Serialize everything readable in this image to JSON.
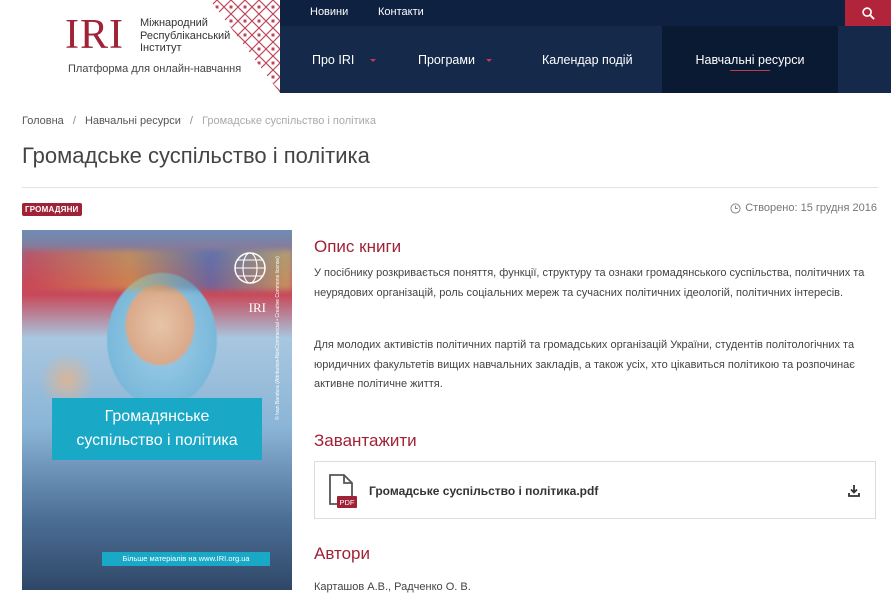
{
  "logo": {
    "mark": "IRI",
    "name_line1": "Міжнародний",
    "name_line2": "Республіканський",
    "name_line3": "Інститут",
    "subtitle": "Платформа для онлайн-навчання"
  },
  "topnav": {
    "news": "Новини",
    "contacts": "Контакти"
  },
  "mainnav": {
    "about": "Про IRI",
    "programs": "Програми",
    "calendar": "Календар подій",
    "resources": "Навчальні ресурси"
  },
  "breadcrumb": {
    "home": "Головна",
    "section": "Навчальні ресурси",
    "current": "Громадське суспільство і політика",
    "separator": "/"
  },
  "page": {
    "title": "Громадське суспільство і політика",
    "tag": "ГРОМАДЯНИ",
    "created": "Створено: 15 грудня 2016"
  },
  "cover": {
    "logo_text": "IRI",
    "title_line1": "Громадянське",
    "title_line2": "суспільство і політика",
    "footer": "Більше матеріалів на www.IRI.org.ua",
    "credit": "© Ivan Bandura  (Attribution-NonCommercial • Creative Commons license)"
  },
  "description": {
    "heading": "Опис книги",
    "p1": "У посібнику розкривається поняття, функції, структуру та ознаки громадянського суспільства, політичних та неурядових організацій, роль соціальних мереж та сучасних політичних ідеологій, політичних інтересів.",
    "p2": "Для молодих активістів політичних партій та громадських організацій України, студентів політологічних та юридичних факультетів вищих навчальних закладів, а також усіх, хто цікавиться політикою та розпочинає активне політичне життя."
  },
  "download": {
    "heading": "Завантажити",
    "file_badge": "PDF",
    "file_name": "Громадське суспільство і політика.pdf"
  },
  "authors": {
    "heading": "Автори",
    "names": "Карташов А.В., Радченко О. В."
  },
  "colors": {
    "brand": "#a02236",
    "navy": "#15294b",
    "cover_accent": "#1aa8c7"
  }
}
